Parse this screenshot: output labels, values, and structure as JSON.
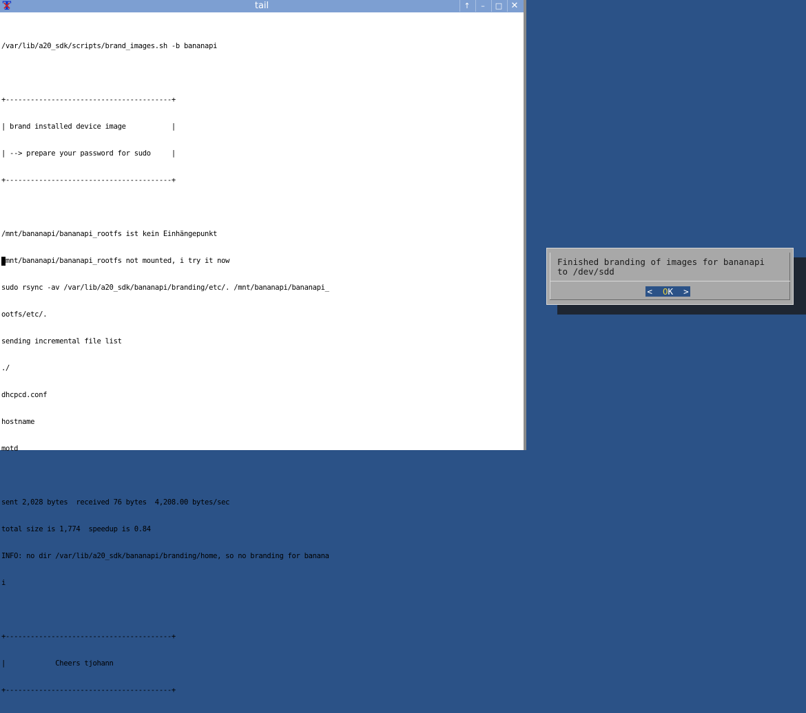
{
  "window": {
    "title": "tail",
    "app_icon_letter": "T",
    "app_icon_mark": "✕",
    "buttons": {
      "up": "↑",
      "minimize": "–",
      "maximize": "□",
      "close": "✕"
    }
  },
  "terminal": {
    "lines": [
      "/var/lib/a20_sdk/scripts/brand_images.sh -b bananapi",
      "",
      "+----------------------------------------+",
      "| brand installed device image           |",
      "| --> prepare your password for sudo     |",
      "+----------------------------------------+",
      "",
      "/mnt/bananapi/bananapi_rootfs ist kein Einhängepunkt",
      "/mnt/bananapi/bananapi_rootfs not mounted, i try it now",
      "sudo rsync -av /var/lib/a20_sdk/bananapi/branding/etc/. /mnt/bananapi/bananapi_",
      "ootfs/etc/.",
      "sending incremental file list",
      "./",
      "dhcpcd.conf",
      "hostname",
      "motd",
      "",
      "sent 2,028 bytes  received 76 bytes  4,208.00 bytes/sec",
      "total size is 1,774  speedup is 0.84",
      "INFO: no dir /var/lib/a20_sdk/bananapi/branding/home, so no branding for banana",
      "i",
      "",
      "+----------------------------------------+",
      "|            Cheers tjohann              ",
      "+----------------------------------------+"
    ]
  },
  "dialog": {
    "message": "Finished branding of images for bananapi\nto /dev/sdd",
    "ok_left": "<  ",
    "ok_hot": "O",
    "ok_rest": "K",
    "ok_right": "  >"
  }
}
